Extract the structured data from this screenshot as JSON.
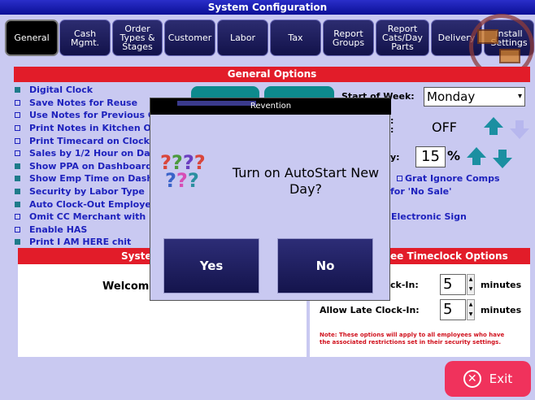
{
  "window": {
    "title": "System Configuration"
  },
  "tabs": [
    {
      "label": "General"
    },
    {
      "label": "Cash Mgmt."
    },
    {
      "label": "Order Types & Stages"
    },
    {
      "label": "Customer"
    },
    {
      "label": "Labor"
    },
    {
      "label": "Tax"
    },
    {
      "label": "Report Groups"
    },
    {
      "label": "Report Cats/Day Parts"
    },
    {
      "label": "Delivery"
    },
    {
      "label": "Install Settings"
    }
  ],
  "general_options": {
    "title": "General Options",
    "items": [
      {
        "label": "Digital Clock",
        "checked": true
      },
      {
        "label": "Save Notes for Reuse",
        "checked": false
      },
      {
        "label": "Use Notes for Previous Or",
        "checked": false
      },
      {
        "label": "Print Notes in Kitchen Only",
        "checked": false
      },
      {
        "label": "Print Timecard on Clockou",
        "checked": false
      },
      {
        "label": "Sales by 1/2 Hour on Dash",
        "checked": false
      },
      {
        "label": "Show PPA on Dashboard",
        "checked": true
      },
      {
        "label": "Show Emp Time on Dashb",
        "checked": true
      },
      {
        "label": "Security by Labor Type",
        "checked": true
      },
      {
        "label": "Auto Clock-Out Employee",
        "checked": true
      },
      {
        "label": "Omit CC Merchant with Ele",
        "checked": false
      },
      {
        "label": "Enable HAS",
        "checked": false
      },
      {
        "label": "Print I AM HERE chit",
        "checked": true
      }
    ],
    "start_of_week_label": "Start of Week:",
    "start_of_week_value": "Monday",
    "off_value": "OFF",
    "pct_value": "15",
    "pct_sign": "%",
    "grat_ignore_comps": "Grat Ignore Comps",
    "no_sale_text": "for 'No Sale'",
    "electronic_sign_text": "Electronic Sign"
  },
  "system_panel": {
    "title": "Syste",
    "welcome": "Welcome"
  },
  "timeclock": {
    "title": "ee Timeclock Options",
    "early_label": "ck-In:",
    "early_value": "5",
    "late_label": "Allow Late Clock-In:",
    "late_value": "5",
    "minutes_label": "minutes",
    "note": "Note: These options will apply to all employees who have the associated restrictions set in their security settings."
  },
  "modal": {
    "title": "Revention",
    "message": "Turn on AutoStart New Day?",
    "yes_label": "Yes",
    "no_label": "No"
  },
  "exit": {
    "label": "Exit"
  },
  "colors": {
    "accent_red": "#e21c29",
    "nav_blue": "#0b0f96",
    "teal": "#0d8a8d",
    "exit_pink": "#f0325c"
  }
}
